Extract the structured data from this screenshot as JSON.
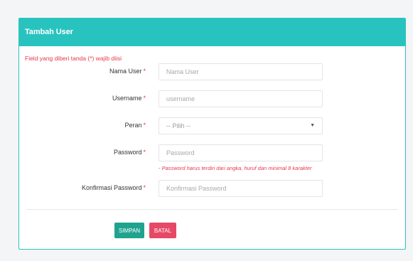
{
  "card": {
    "title": "Tambah User",
    "required_note": "Field yang diberi tanda (*) wajib diisi"
  },
  "form": {
    "required_mark": "*",
    "fields": [
      {
        "label": "Nama User",
        "placeholder": "Nama User",
        "value": ""
      },
      {
        "label": "Username",
        "placeholder": "username",
        "value": ""
      },
      {
        "label": "Peran",
        "selected": "-- Pilih --"
      },
      {
        "label": "Password",
        "placeholder": "Password",
        "value": "",
        "hint": "- Password harus terdiri dari angka, huruf dan minimal 8 karakter"
      },
      {
        "label": "Konfirmasi Password",
        "placeholder": "Konfirmasi Password",
        "value": ""
      }
    ],
    "select_arrow": "▼"
  },
  "actions": {
    "save_label": "SIMPAN",
    "cancel_label": "BATAL"
  },
  "colors": {
    "header": "#29c3bf",
    "required": "#e8374d",
    "save": "#1fa38f",
    "cancel": "#e74866"
  }
}
